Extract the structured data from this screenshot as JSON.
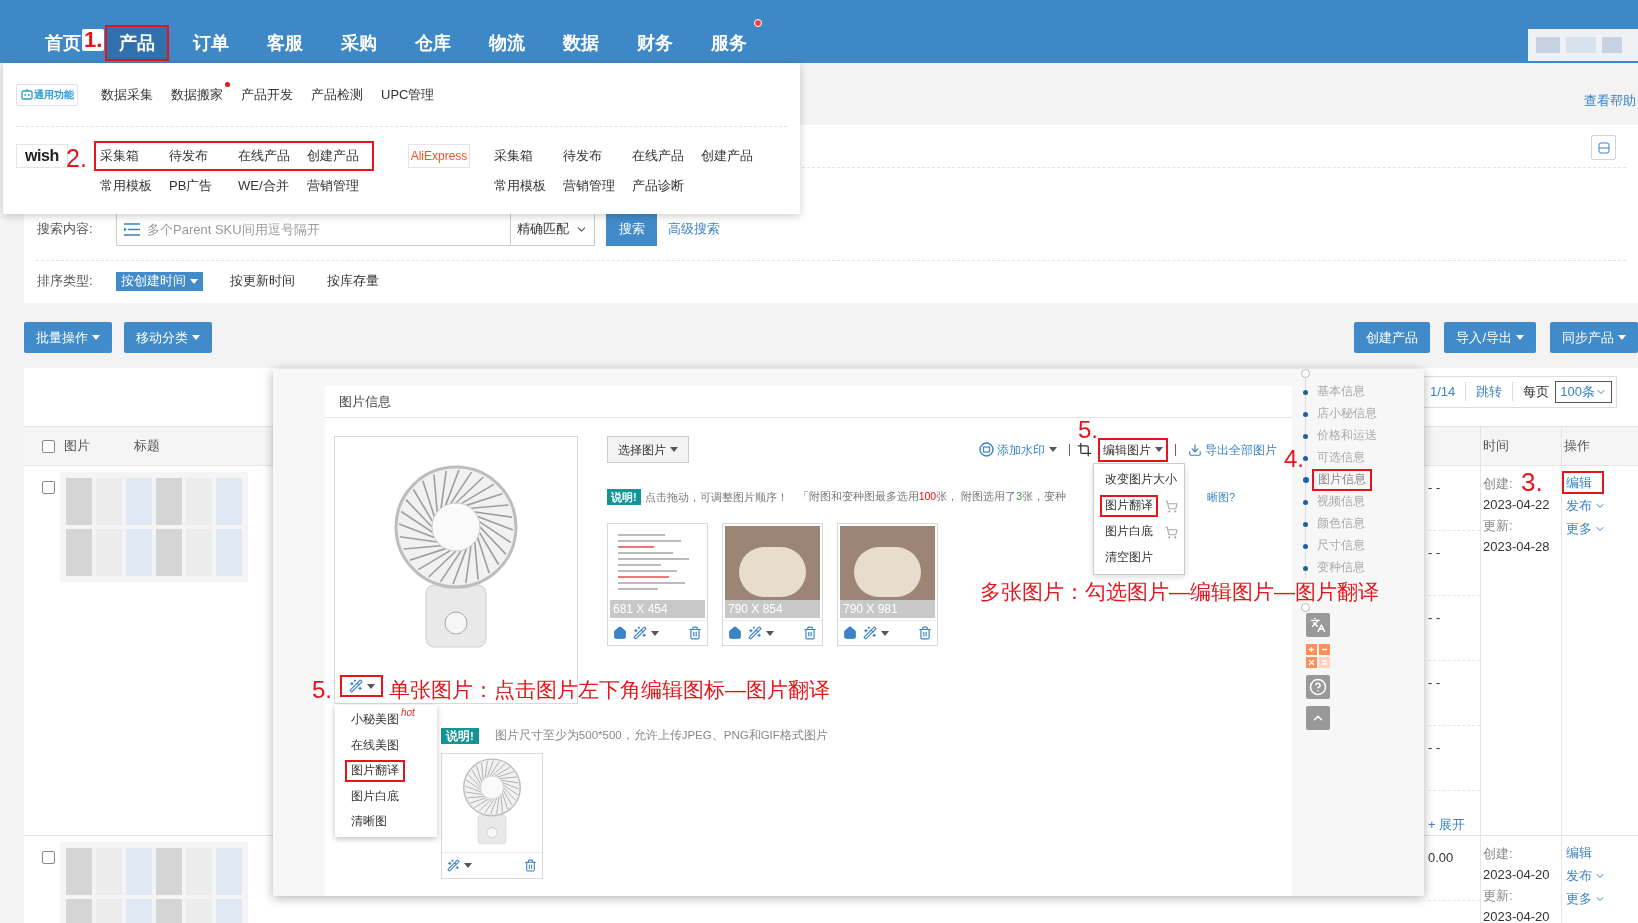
{
  "nav": {
    "annotation": "1.",
    "items": [
      {
        "label": "首页",
        "selected": false,
        "highlighted": false,
        "dot": false
      },
      {
        "label": "产品",
        "selected": true,
        "highlighted": true,
        "dot": false
      },
      {
        "label": "订单",
        "selected": false,
        "highlighted": false,
        "dot": false
      },
      {
        "label": "客服",
        "selected": false,
        "highlighted": false,
        "dot": false
      },
      {
        "label": "采购",
        "selected": false,
        "highlighted": false,
        "dot": false
      },
      {
        "label": "仓库",
        "selected": false,
        "highlighted": false,
        "dot": false
      },
      {
        "label": "物流",
        "selected": false,
        "highlighted": false,
        "dot": false
      },
      {
        "label": "数据",
        "selected": false,
        "highlighted": false,
        "dot": false
      },
      {
        "label": "财务",
        "selected": false,
        "highlighted": false,
        "dot": false
      },
      {
        "label": "服务",
        "selected": false,
        "highlighted": false,
        "dot": true
      }
    ]
  },
  "menu": {
    "general": {
      "badge": "通用功能",
      "items": [
        {
          "label": "数据采集",
          "dot": false
        },
        {
          "label": "数据搬家",
          "dot": true
        },
        {
          "label": "产品开发",
          "dot": false
        },
        {
          "label": "产品检测",
          "dot": false
        },
        {
          "label": "UPC管理",
          "dot": false
        }
      ]
    },
    "platforms": [
      {
        "logo": "wish",
        "kind": "wish",
        "annotation": "2.",
        "rows": [
          {
            "highlighted": true,
            "items": [
              "采集箱",
              "待发布",
              "在线产品",
              "创建产品"
            ]
          },
          {
            "highlighted": false,
            "items": [
              "常用模板",
              "PB广告",
              "WE/合并",
              "营销管理"
            ]
          }
        ]
      },
      {
        "logo": "AliExpress",
        "kind": "aliexpress",
        "rows": [
          {
            "highlighted": false,
            "items": [
              "采集箱",
              "待发布",
              "在线产品",
              "创建产品"
            ]
          },
          {
            "highlighted": false,
            "items": [
              "常用模板",
              "营销管理",
              "产品诊断"
            ]
          }
        ]
      }
    ]
  },
  "help_link": "查看帮助",
  "filter": {
    "search_label": "搜索内容:",
    "search_placeholder": "多个Parent SKU间用逗号隔开",
    "match_select": "精确匹配",
    "search_button": "搜索",
    "advanced_link": "高级搜索",
    "sort_label": "排序类型:",
    "sort_options": [
      {
        "label": "按创建时间",
        "selected": true
      },
      {
        "label": "按更新时间",
        "selected": false
      },
      {
        "label": "按库存量",
        "selected": false
      }
    ]
  },
  "toolbar": {
    "left": [
      {
        "label": "批量操作",
        "dropdown": true
      },
      {
        "label": "移动分类",
        "dropdown": true
      }
    ],
    "right": [
      {
        "label": "创建产品",
        "dropdown": false
      },
      {
        "label": "导入/导出",
        "dropdown": true
      },
      {
        "label": "同步产品",
        "dropdown": true
      }
    ]
  },
  "pagination": {
    "page": "1/14",
    "jump": "跳转",
    "per_page_label": "每页",
    "per_page": "100条"
  },
  "table": {
    "header_checked": false,
    "columns": [
      {
        "label": "图片"
      },
      {
        "label": "标题"
      },
      {
        "label": "时间"
      },
      {
        "label": "操作"
      }
    ],
    "rows": [
      {
        "checked": false,
        "values": [
          "- -",
          "- -",
          "- -",
          "- -",
          "- -"
        ],
        "expand": "+ 展开",
        "created_label": "创建:",
        "created": "2023-04-22",
        "updated_label": "更新:",
        "updated": "2023-04-28",
        "annotation": "3.",
        "actions": [
          {
            "label": "编辑",
            "dropdown": false,
            "highlighted": true
          },
          {
            "label": "发布",
            "dropdown": true,
            "highlighted": false
          },
          {
            "label": "更多",
            "dropdown": true,
            "highlighted": false
          }
        ]
      },
      {
        "checked": false,
        "values": [
          "0.00"
        ],
        "created_label": "创建:",
        "created": "2023-04-20",
        "updated_label": "更新:",
        "updated": "2023-04-20",
        "actions": [
          {
            "label": "编辑",
            "dropdown": false,
            "highlighted": false
          },
          {
            "label": "发布",
            "dropdown": true,
            "highlighted": false
          },
          {
            "label": "更多",
            "dropdown": true,
            "highlighted": false
          }
        ]
      }
    ]
  },
  "editor": {
    "section_title": "图片信息",
    "choose_button": "选择图片",
    "tools": [
      {
        "label": "添加水印",
        "dropdown": true,
        "highlighted": false
      },
      {
        "label": "编辑图片",
        "dropdown": true,
        "highlighted": true,
        "annotation": "5."
      },
      {
        "label": "导出全部图片",
        "dropdown": false,
        "highlighted": false
      }
    ],
    "edit_menu": [
      {
        "label": "改变图片大小",
        "paid": false,
        "highlighted": false
      },
      {
        "label": "图片翻译",
        "paid": true,
        "highlighted": true
      },
      {
        "label": "图片白底",
        "paid": true,
        "highlighted": false
      },
      {
        "label": "清空图片",
        "paid": false,
        "highlighted": false
      }
    ],
    "note": {
      "badge": "说明!",
      "lead": "点击拖动，可调整图片顺序！",
      "detail": [
        {
          "text": "「附图和变种图最多选用",
          "kind": "text"
        },
        {
          "text": "100",
          "kind": "limit"
        },
        {
          "text": "张， 附图选用了",
          "kind": "text"
        },
        {
          "text": "3",
          "kind": "count"
        },
        {
          "text": "张，变种",
          "kind": "text"
        }
      ],
      "link": "晰图?"
    },
    "thumbnails": [
      {
        "size": "681 X 454",
        "kind": "document"
      },
      {
        "size": "790 X 854",
        "kind": "photo"
      },
      {
        "size": "790 X 981",
        "kind": "photo"
      }
    ],
    "multi_annotation": "多张图片：勾选图片—编辑图片—图片翻译",
    "single_number": "5.",
    "single_highlighted": true,
    "single_annotation": "单张图片：点击图片左下角编辑图标—图片翻译",
    "single_menu": [
      {
        "label": "小秘美图",
        "tag": "hot",
        "highlighted": false
      },
      {
        "label": "在线美图",
        "highlighted": false
      },
      {
        "label": "图片翻译",
        "highlighted": true
      },
      {
        "label": "图片白底",
        "highlighted": false
      },
      {
        "label": "清晰图",
        "highlighted": false
      }
    ],
    "upload_note": {
      "badge": "说明!",
      "text": "图片尺寸至少为500*500，允许上传JPEG、PNG和GIF格式图片"
    },
    "side_annotation": "4.",
    "side_nav": [
      {
        "label": "基本信息",
        "selected": false,
        "highlighted": false
      },
      {
        "label": "店小秘信息",
        "selected": false,
        "highlighted": false
      },
      {
        "label": "价格和运送",
        "selected": false,
        "highlighted": false
      },
      {
        "label": "可选信息",
        "selected": false,
        "highlighted": false
      },
      {
        "label": "图片信息",
        "selected": true,
        "highlighted": true
      },
      {
        "label": "视频信息",
        "selected": false,
        "highlighted": false
      },
      {
        "label": "颜色信息",
        "selected": false,
        "highlighted": false
      },
      {
        "label": "尺寸信息",
        "selected": false,
        "highlighted": false
      },
      {
        "label": "变种信息",
        "selected": false,
        "highlighted": false
      }
    ]
  }
}
